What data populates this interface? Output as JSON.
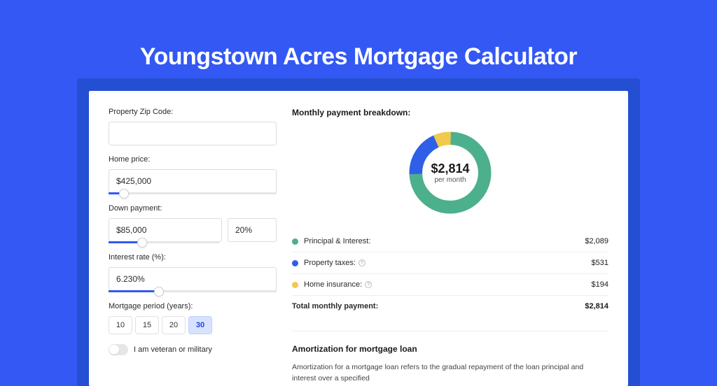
{
  "page_title": "Youngstown Acres Mortgage Calculator",
  "form": {
    "zip_label": "Property Zip Code:",
    "zip_value": "",
    "home_price_label": "Home price:",
    "home_price_value": "$425,000",
    "home_price_slider_pct": 9,
    "down_payment_label": "Down payment:",
    "down_payment_value": "$85,000",
    "down_payment_pct_value": "20%",
    "down_payment_slider_pct": 20,
    "interest_label": "Interest rate (%):",
    "interest_value": "6.230%",
    "interest_slider_pct": 30,
    "period_label": "Mortgage period (years):",
    "periods": [
      "10",
      "15",
      "20",
      "30"
    ],
    "period_active": "30",
    "veteran_label": "I am veteran or military",
    "veteran_on": false
  },
  "breakdown": {
    "title": "Monthly payment breakdown:",
    "total_value": "$2,814",
    "total_sub": "per month",
    "items": [
      {
        "label": "Principal & Interest:",
        "value": "$2,089",
        "color": "#4cb08c",
        "info": false
      },
      {
        "label": "Property taxes:",
        "value": "$531",
        "color": "#2f5fe6",
        "info": true
      },
      {
        "label": "Home insurance:",
        "value": "$194",
        "color": "#f1c94b",
        "info": true
      }
    ],
    "total_label": "Total monthly payment:",
    "total_row_value": "$2,814"
  },
  "chart_data": {
    "type": "pie",
    "title": "Monthly payment breakdown",
    "series": [
      {
        "name": "Principal & Interest",
        "value": 2089,
        "color": "#4cb08c"
      },
      {
        "name": "Property taxes",
        "value": 531,
        "color": "#2f5fe6"
      },
      {
        "name": "Home insurance",
        "value": 194,
        "color": "#f1c94b"
      }
    ],
    "total": 2814,
    "center_label": "$2,814",
    "center_sub": "per month"
  },
  "amortization": {
    "title": "Amortization for mortgage loan",
    "text": "Amortization for a mortgage loan refers to the gradual repayment of the loan principal and interest over a specified"
  }
}
